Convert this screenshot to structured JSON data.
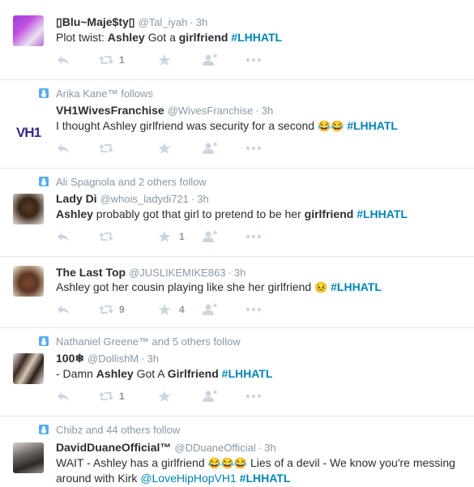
{
  "tweets": [
    {
      "name": "▯Blu~Maje$ty▯",
      "handle": "@Tal_iyah",
      "time": "3h",
      "text_parts": [
        {
          "t": "Plot twist: ",
          "s": "plain"
        },
        {
          "t": "Ashley",
          "s": "bold"
        },
        {
          "t": " Got a ",
          "s": "plain"
        },
        {
          "t": "girlfriend",
          "s": "bold"
        },
        {
          "t": " #LHHATL",
          "s": "tag"
        }
      ],
      "retweets": "1",
      "favorites": ""
    },
    {
      "context": "Arika Kane™ follows",
      "name": "VH1WivesFranchise",
      "handle": "@WivesFranchise",
      "time": "3h",
      "avatar_text": "VH1",
      "text_parts": [
        {
          "t": "I thought Ashley girlfriend was security for a second ",
          "s": "plain"
        },
        {
          "t": "😂😂",
          "s": "emoji"
        },
        {
          "t": " #LHHATL",
          "s": "tag"
        }
      ],
      "retweets": "",
      "favorites": ""
    },
    {
      "context": "Ali Spagnola and 2 others follow",
      "name": "Lady Di",
      "handle": "@whois_ladydi721",
      "time": "3h",
      "text_parts": [
        {
          "t": "Ashley",
          "s": "bold"
        },
        {
          "t": " probably got that girl to pretend to be her ",
          "s": "plain"
        },
        {
          "t": "girlfriend",
          "s": "bold"
        },
        {
          "t": " #LHHATL",
          "s": "tag"
        }
      ],
      "retweets": "",
      "favorites": "1"
    },
    {
      "name": "The Last Top",
      "handle": "@JUSLIKEMIKE863",
      "time": "3h",
      "text_parts": [
        {
          "t": "Ashley got her cousin playing like she her girlfriend ",
          "s": "plain"
        },
        {
          "t": "😣",
          "s": "emoji"
        },
        {
          "t": " #LHHATL",
          "s": "tag"
        }
      ],
      "retweets": "9",
      "favorites": "4"
    },
    {
      "context": "Nathaniel Greene™ and 5 others follow",
      "name": "100❄",
      "handle": "@DollishM",
      "time": "3h",
      "text_parts": [
        {
          "t": "- Damn ",
          "s": "plain"
        },
        {
          "t": "Ashley",
          "s": "bold"
        },
        {
          "t": " Got A ",
          "s": "plain"
        },
        {
          "t": "Girlfriend",
          "s": "bold"
        },
        {
          "t": " #LHHATL",
          "s": "tag"
        }
      ],
      "retweets": "1",
      "favorites": ""
    },
    {
      "context": "Chibz and 44 others follow",
      "name": "DavidDuaneOfficial™",
      "handle": "@DDuaneOfficial",
      "time": "3h",
      "text_parts": [
        {
          "t": "WAIT - Ashley has a girlfriend ",
          "s": "plain"
        },
        {
          "t": "😂😂😂",
          "s": "emoji"
        },
        {
          "t": " Lies of a devil - We know you're messing around with Kirk ",
          "s": "plain"
        },
        {
          "t": "@LoveHipHopVH1",
          "s": "mention"
        },
        {
          "t": " #LHHATL",
          "s": "tag"
        }
      ],
      "retweets": "",
      "favorites": ""
    }
  ],
  "colors": {
    "link": "#0084b4",
    "meta": "#8899a6",
    "icon": "#ccd6dd",
    "context_icon": "#55acee",
    "divider": "#e1e8ed"
  },
  "icons": [
    "reply-icon",
    "retweet-icon",
    "favorite-icon",
    "follow-icon",
    "more-icon",
    "followed-by-icon"
  ]
}
